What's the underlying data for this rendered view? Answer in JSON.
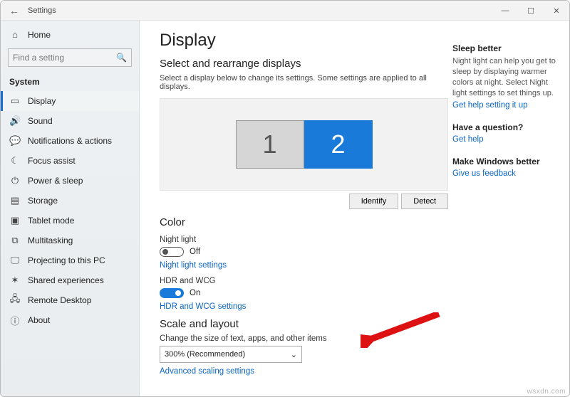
{
  "titlebar": {
    "title": "Settings"
  },
  "sidebar": {
    "home": "Home",
    "search_placeholder": "Find a setting",
    "heading": "System",
    "items": [
      {
        "label": "Display",
        "icon": "▭"
      },
      {
        "label": "Sound",
        "icon": "🔊"
      },
      {
        "label": "Notifications & actions",
        "icon": "💬"
      },
      {
        "label": "Focus assist",
        "icon": "☾"
      },
      {
        "label": "Power & sleep",
        "icon": "⏻"
      },
      {
        "label": "Storage",
        "icon": "▤"
      },
      {
        "label": "Tablet mode",
        "icon": "▣"
      },
      {
        "label": "Multitasking",
        "icon": "⧉"
      },
      {
        "label": "Projecting to this PC",
        "icon": "🖵"
      },
      {
        "label": "Shared experiences",
        "icon": "✶"
      },
      {
        "label": "Remote Desktop",
        "icon": "🖧"
      },
      {
        "label": "About",
        "icon": "ⓘ"
      }
    ]
  },
  "main": {
    "page_title": "Display",
    "arrange_heading": "Select and rearrange displays",
    "arrange_desc": "Select a display below to change its settings. Some settings are applied to all displays.",
    "monitor1": "1",
    "monitor2": "2",
    "identify_btn": "Identify",
    "detect_btn": "Detect",
    "color_heading": "Color",
    "night_light_label": "Night light",
    "night_light_state": "Off",
    "night_light_link": "Night light settings",
    "hdr_label": "HDR and WCG",
    "hdr_state": "On",
    "hdr_link": "HDR and WCG settings",
    "scale_heading": "Scale and layout",
    "scale_label": "Change the size of text, apps, and other items",
    "scale_value": "300% (Recommended)",
    "adv_scale_link": "Advanced scaling settings"
  },
  "tips": {
    "sleep_title": "Sleep better",
    "sleep_body": "Night light can help you get to sleep by displaying warmer colors at night. Select Night light settings to set things up.",
    "sleep_link": "Get help setting it up",
    "q_title": "Have a question?",
    "q_link": "Get help",
    "wb_title": "Make Windows better",
    "wb_link": "Give us feedback"
  },
  "watermark": "wsxdn.com"
}
